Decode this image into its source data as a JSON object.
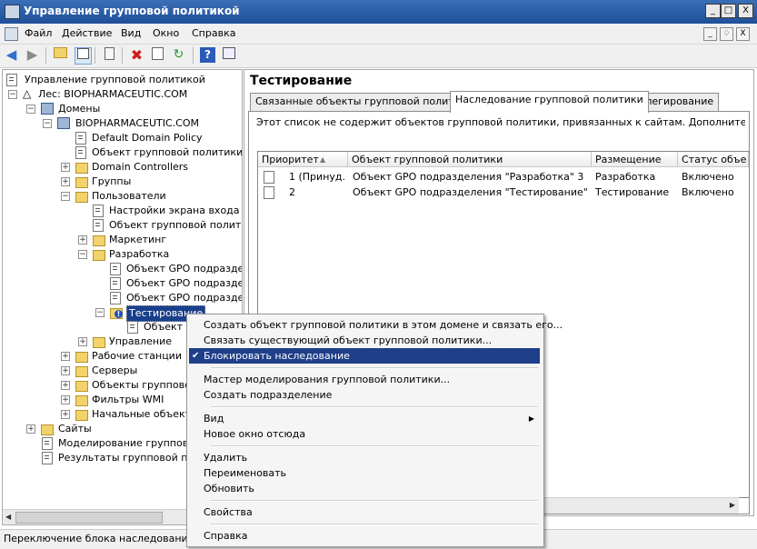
{
  "window": {
    "title": "Управление групповой политикой",
    "controls": [
      "_",
      "□",
      "X"
    ]
  },
  "menubar": {
    "items": [
      "Файл",
      "Действие",
      "Вид",
      "Окно",
      "Справка"
    ],
    "mdi_controls": [
      "_",
      "♢",
      "X"
    ]
  },
  "toolbar": {
    "icons": [
      "back-icon",
      "forward-icon",
      "up-folder-icon",
      "show-tree-icon",
      "clipboard-icon",
      "delete-icon",
      "properties-icon",
      "refresh-icon",
      "help-icon",
      "console-icon"
    ]
  },
  "tree": {
    "root": "Управление групповой политикой",
    "forest": "Лес: BIOPHARMACEUTIC.COM",
    "domains": "Домены",
    "domain": "BIOPHARMACEUTIC.COM",
    "default_policy": "Default Domain Policy",
    "linked_gpo": "Объект групповой политики до",
    "dc": "Domain Controllers",
    "groups": "Группы",
    "users": "Пользователи",
    "users_child1": "Настройки экрана входа в с",
    "users_child2": "Объект групповой политик",
    "marketing": "Маркетинг",
    "dev": "Разработка",
    "dev_gpo1": "Объект GPO подразделе",
    "dev_gpo2": "Объект GPO подраздел",
    "dev_gpo3": "Объект GPO подразделе",
    "testing": "Тестирование",
    "testing_gpo": "Объект G",
    "management": "Управление",
    "workstations": "Рабочие станции",
    "servers": "Серверы",
    "gp_objects": "Объекты групповой",
    "wmi_filters": "Фильтры WMI",
    "starter_gpos": "Начальные объекть",
    "sites": "Сайты",
    "modeling": "Моделирование групповой",
    "results": "Результаты групповой поли"
  },
  "right": {
    "title": "Тестирование",
    "tabs": [
      "Связанные объекты групповой политики",
      "Наследование групповой политики",
      "Делегирование"
    ],
    "active_tab": 1,
    "info": "Этот список не содержит объектов групповой политики, привязанных к сайтам. Дополнительные сведе",
    "columns": [
      "Приоритет",
      "Объект групповой политики",
      "Размещение",
      "Статус объе"
    ],
    "rows": [
      {
        "priority": "1 (Принуд...",
        "gpo": "Объект GPO подразделения \"Разработка\" 3",
        "location": "Разработка",
        "status": "Включено"
      },
      {
        "priority": "2",
        "gpo": "Объект GPO подразделения \"Тестирование\"",
        "location": "Тестирование",
        "status": "Включено"
      }
    ]
  },
  "context_menu": {
    "items": [
      "Создать объект групповой политики в этом домене и связать его...",
      "Связать существующий объект групповой политики...",
      "Блокировать наследование",
      "Мастер моделирования групповой политики...",
      "Создать подразделение",
      "Вид",
      "Новое окно отсюда",
      "Удалить",
      "Переименовать",
      "Обновить",
      "Свойства",
      "Справка"
    ],
    "checked_item": "Блокировать наследование"
  },
  "statusbar": {
    "text": "Переключение блока наследования"
  },
  "colors": {
    "title_bar": "#1f4f99",
    "selection": "#1a3f8c",
    "menu_highlight": "#1f3f8a"
  }
}
